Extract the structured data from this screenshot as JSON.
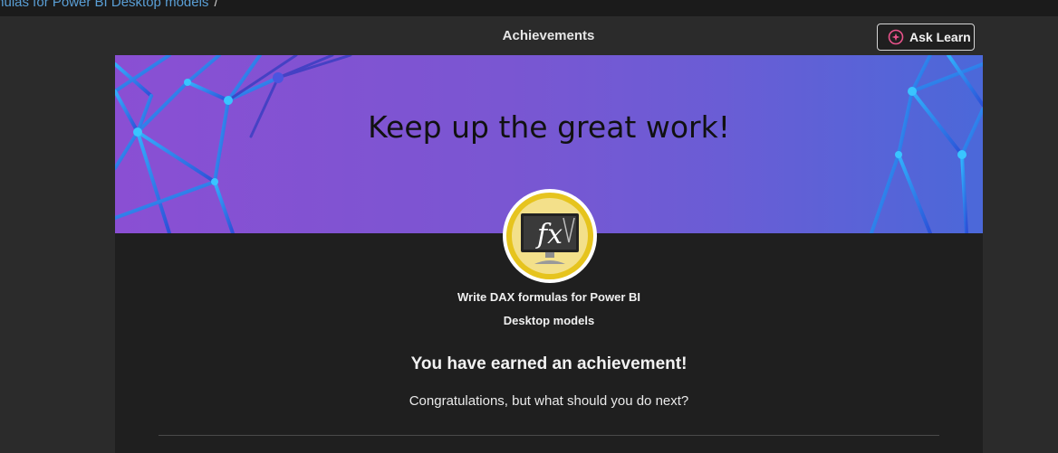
{
  "breadcrumb": {
    "current": "mulas for Power BI Desktop models",
    "separator": "/"
  },
  "modal": {
    "title": "Achievements",
    "ask_learn_label": "Ask Learn"
  },
  "banner": {
    "heading": "Keep up the great work!"
  },
  "achievement": {
    "badge_icon": "fx-monitor-icon",
    "name": "Write DAX formulas for Power BI Desktop models"
  },
  "message": {
    "earned": "You have earned an achievement!",
    "next_prompt": "Congratulations, but what should you do next?"
  },
  "colors": {
    "banner_start": "#8a4fd3",
    "banner_end": "#4b68d9",
    "badge_ring": "#e6c41e",
    "page_bg": "#2b2b2b",
    "card_bg": "#1f1f1f",
    "link": "#5a9fd6"
  }
}
